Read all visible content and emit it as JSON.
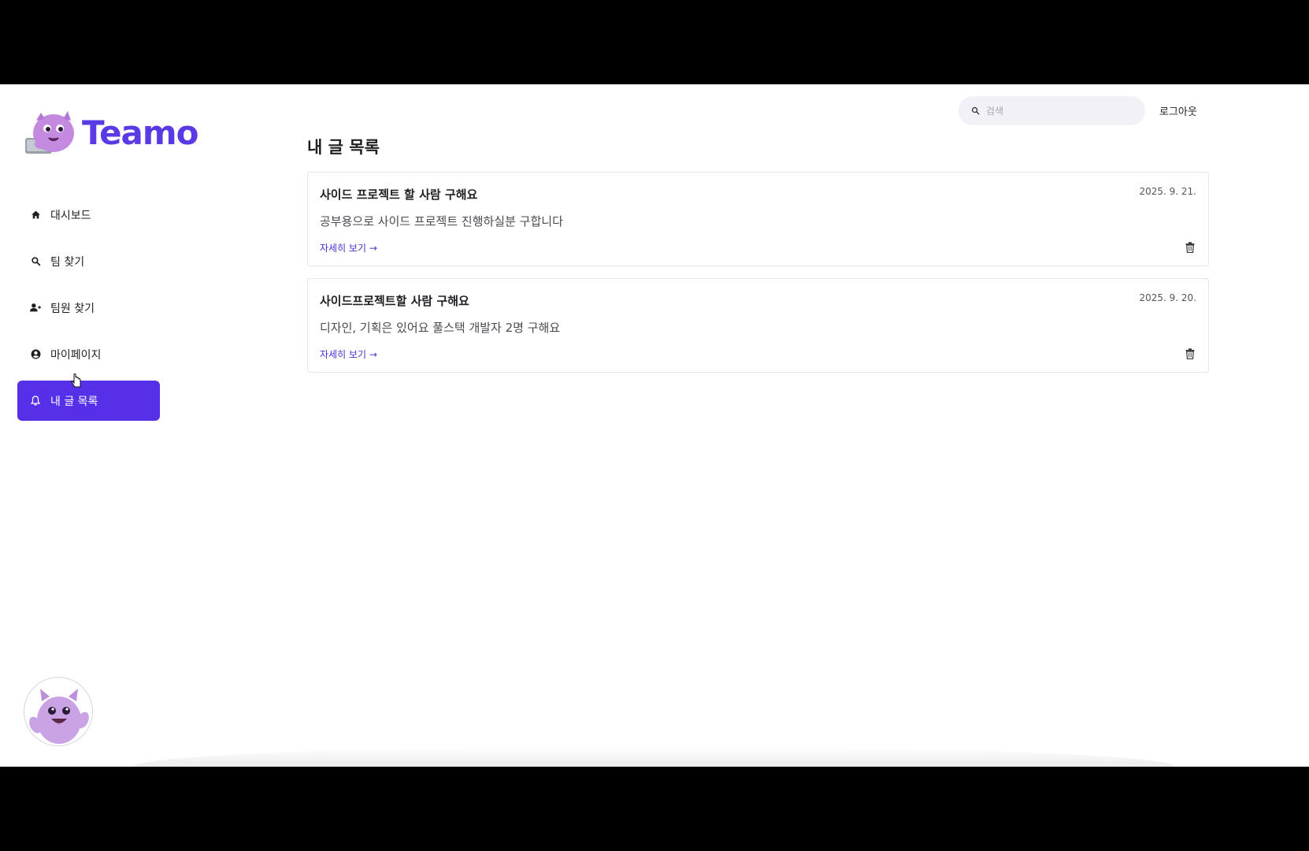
{
  "brand": {
    "name": "Teamo",
    "accent": "#5530e8"
  },
  "sidebar": {
    "items": [
      {
        "label": "대시보드",
        "icon": "home-icon"
      },
      {
        "label": "팀 찾기",
        "icon": "search-icon"
      },
      {
        "label": "팀원 찾기",
        "icon": "person-add-icon"
      },
      {
        "label": "마이페이지",
        "icon": "account-circle-icon"
      },
      {
        "label": "내 글 목록",
        "icon": "bell-icon",
        "active": true
      }
    ]
  },
  "header": {
    "search_placeholder": "검색",
    "logout_label": "로그아웃"
  },
  "main": {
    "title": "내 글 목록",
    "posts": [
      {
        "title": "사이드 프로젝트 할 사람 구해요",
        "date": "2025. 9. 21.",
        "body": "공부용으로 사이드 프로젝트 진행하실분 구합니다",
        "link_label": "자세히 보기 →"
      },
      {
        "title": "사이드프로젝트할 사람 구해요",
        "date": "2025. 9. 20.",
        "body": "디자인, 기획은 있어요 풀스택 개발자 2명 구해요",
        "link_label": "자세히 보기 →"
      }
    ]
  }
}
